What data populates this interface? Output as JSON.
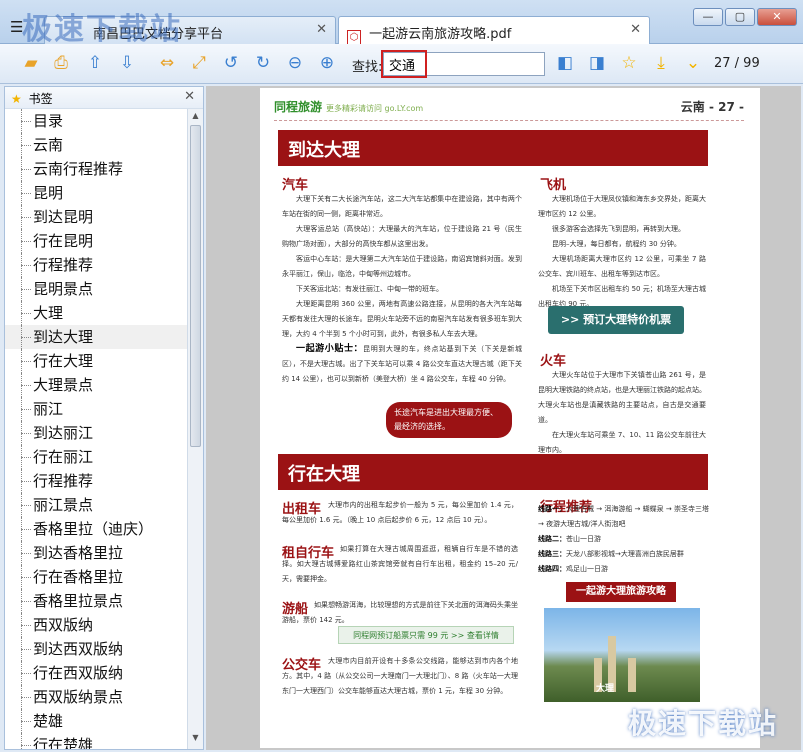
{
  "watermark": "极速下载站",
  "tabs": [
    {
      "label": "南昌巴巴文档分享平台"
    },
    {
      "label": "一起游云南旅游攻略.pdf"
    }
  ],
  "window_buttons": [
    "—",
    "▢",
    "✕"
  ],
  "toolbar": {
    "icons": [
      "folder-open-icon",
      "print-icon",
      "arrow-up-icon",
      "arrow-down-icon",
      "fit-width-icon",
      "fit-page-icon",
      "rotate-left-icon",
      "rotate-right-icon",
      "zoom-out-icon",
      "zoom-in-icon"
    ],
    "search_label": "查找:",
    "search_value": "交通",
    "right_icons": [
      "prev-result-icon",
      "next-result-icon",
      "star-icon",
      "download-icon",
      "collapse-icon"
    ],
    "page_counter": "27 / 99"
  },
  "sidebar": {
    "title": "书签",
    "items": [
      "目录",
      "云南",
      "云南行程推荐",
      "昆明",
      "到达昆明",
      "行在昆明",
      "行程推荐",
      "昆明景点",
      "大理",
      "到达大理",
      "行在大理",
      "大理景点",
      "丽江",
      "到达丽江",
      "行在丽江",
      "行程推荐",
      "丽江景点",
      "香格里拉（迪庆）",
      "到达香格里拉",
      "行在香格里拉",
      "香格里拉景点",
      "西双版纳",
      "到达西双版纳",
      "行在西双版纳",
      "西双版纳景点",
      "楚雄",
      "行在楚雄"
    ],
    "active_index": 9
  },
  "page": {
    "brand": "同程旅游",
    "brand_sub": "更多精彩请访问 go.LY.com",
    "page_num": "云南 - 27 -",
    "section1_title": "到达大理",
    "car_title": "汽车",
    "car_paras": [
      "大理下关有二大长途汽车站，这二大汽车站都集中在建设路，其中有两个车站在街的同一侧，距离非常近。",
      "大理客运总站（高快站）：大理最大的汽车站，位于建设路 21 号（民生购物广场对面），大部分的高快车都从这里出发。",
      "客运中心车站：是大理第二大汽车站位于建设路，南诏宾馆斜对面。发到永平丽江，保山，临沧，中甸等州边城市。",
      "下关客运北站：有发往丽江、中甸一带的班车。",
      "大理距离昆明 360 公里，两地有高速公路连接，从昆明的各大汽车站每天都有发往大理的长途车。昆明火车站旁不远的南窑汽车站发有很多班车到大理，大约 4 个半到 5 个小时可到，此外，有很多私人车去大理。"
    ],
    "tip_label": "一起游小贴士：",
    "tip_text": "昆明到大理的车，终点站基到下关（下关是新城区），不是大理古城。出了下关车站可以乘 4 路公交车直达大理古城（距下关约 14 公里），也可以到新桥（美登大桥）坐 4 路公交车，车程 40 分钟。",
    "bubble": "长途汽车是进出大理最方便、最经济的选择。",
    "plane_title": "飞机",
    "plane_paras": [
      "大理机场位于大理凤仪镇和海东乡交界处，距离大理市区约 12 公里。",
      "很多游客会选择先飞到昆明，再转到大理。",
      "昆明–大理，每日都有，航程约 30 分钟。",
      "大理机场距离大理市区约 12 公里，可乘坐 7 路公交车、宾川班车、出租车等到达市区。",
      "机场至下关市区出租车约 50 元；机场至大理古城出租车约 90 元。"
    ],
    "book_button": ">> 预订大理特价机票",
    "train_title": "火车",
    "train_paras": [
      "大理火车站位于大理市下关镇苍山路 261 号，是昆明大理铁路的终点站，也是大理丽江铁路的起点站。大理火车站也是滇藏铁路的主要站点，自古是交通要道。",
      "在大理火车站可乘坐 7、10、11 路公交车前往大理市内。"
    ],
    "section2_title": "行在大理",
    "taxi_title": "出租车",
    "taxi_text": "大理市内的出租车起步价一般为 5 元，每公里加价 1.4 元，每公里加价 1.6 元。（晚上 10 点后起步价 6 元，12 点后 10 元）。",
    "bike_title": "租自行车",
    "bike_text": "如果打算在大理古城周围逛逛，租辆自行车是不错的选择。如大理古城博爱路红山茶宾馆旁就有自行车出租，租金约 15–20 元/天，需要押金。",
    "boat_title": "游船",
    "boat_text": "如果想畅游洱海，比较理想的方式是前往下关北面的洱海码头乘坐游船，票价 142 元。",
    "promo": "同程网预订船票只需 99 元 >> 查看详情",
    "bus_title": "公交车",
    "bus_text": "大理市内目前开设有十多条公交线路，能够达到市内各个地方。其中，4 路（从公交公司一大理南门一大理北门）、8 路（火车站一大理东门一大理西门）公交车能够直达大理古城，票价 1 元，车程 30 分钟。",
    "itinerary_title": "行程推荐",
    "routes": [
      {
        "label": "线路一：",
        "text": "大理古城 → 洱海游船 → 蝴蝶泉 → 崇圣寺三塔 → 夜游大理古城/洋人街泡吧"
      },
      {
        "label": "线路二：",
        "text": "苍山一日游"
      },
      {
        "label": "线路三：",
        "text": "天龙八部影视城→大理喜洲白族民居群"
      },
      {
        "label": "线路四：",
        "text": "鸡足山一日游"
      }
    ],
    "banner2": "一起游大理旅游攻略",
    "photo_label": "大理"
  }
}
